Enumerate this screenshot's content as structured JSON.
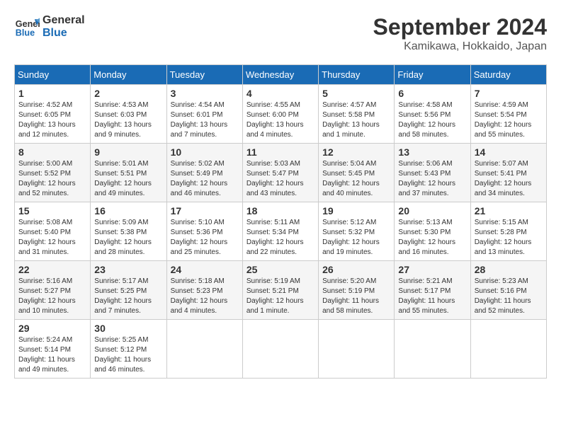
{
  "header": {
    "logo_line1": "General",
    "logo_line2": "Blue",
    "month": "September 2024",
    "location": "Kamikawa, Hokkaido, Japan"
  },
  "weekdays": [
    "Sunday",
    "Monday",
    "Tuesday",
    "Wednesday",
    "Thursday",
    "Friday",
    "Saturday"
  ],
  "weeks": [
    [
      {
        "day": "1",
        "sunrise": "4:52 AM",
        "sunset": "6:05 PM",
        "daylight": "13 hours and 12 minutes."
      },
      {
        "day": "2",
        "sunrise": "4:53 AM",
        "sunset": "6:03 PM",
        "daylight": "13 hours and 9 minutes."
      },
      {
        "day": "3",
        "sunrise": "4:54 AM",
        "sunset": "6:01 PM",
        "daylight": "13 hours and 7 minutes."
      },
      {
        "day": "4",
        "sunrise": "4:55 AM",
        "sunset": "6:00 PM",
        "daylight": "13 hours and 4 minutes."
      },
      {
        "day": "5",
        "sunrise": "4:57 AM",
        "sunset": "5:58 PM",
        "daylight": "13 hours and 1 minute."
      },
      {
        "day": "6",
        "sunrise": "4:58 AM",
        "sunset": "5:56 PM",
        "daylight": "12 hours and 58 minutes."
      },
      {
        "day": "7",
        "sunrise": "4:59 AM",
        "sunset": "5:54 PM",
        "daylight": "12 hours and 55 minutes."
      }
    ],
    [
      {
        "day": "8",
        "sunrise": "5:00 AM",
        "sunset": "5:52 PM",
        "daylight": "12 hours and 52 minutes."
      },
      {
        "day": "9",
        "sunrise": "5:01 AM",
        "sunset": "5:51 PM",
        "daylight": "12 hours and 49 minutes."
      },
      {
        "day": "10",
        "sunrise": "5:02 AM",
        "sunset": "5:49 PM",
        "daylight": "12 hours and 46 minutes."
      },
      {
        "day": "11",
        "sunrise": "5:03 AM",
        "sunset": "5:47 PM",
        "daylight": "12 hours and 43 minutes."
      },
      {
        "day": "12",
        "sunrise": "5:04 AM",
        "sunset": "5:45 PM",
        "daylight": "12 hours and 40 minutes."
      },
      {
        "day": "13",
        "sunrise": "5:06 AM",
        "sunset": "5:43 PM",
        "daylight": "12 hours and 37 minutes."
      },
      {
        "day": "14",
        "sunrise": "5:07 AM",
        "sunset": "5:41 PM",
        "daylight": "12 hours and 34 minutes."
      }
    ],
    [
      {
        "day": "15",
        "sunrise": "5:08 AM",
        "sunset": "5:40 PM",
        "daylight": "12 hours and 31 minutes."
      },
      {
        "day": "16",
        "sunrise": "5:09 AM",
        "sunset": "5:38 PM",
        "daylight": "12 hours and 28 minutes."
      },
      {
        "day": "17",
        "sunrise": "5:10 AM",
        "sunset": "5:36 PM",
        "daylight": "12 hours and 25 minutes."
      },
      {
        "day": "18",
        "sunrise": "5:11 AM",
        "sunset": "5:34 PM",
        "daylight": "12 hours and 22 minutes."
      },
      {
        "day": "19",
        "sunrise": "5:12 AM",
        "sunset": "5:32 PM",
        "daylight": "12 hours and 19 minutes."
      },
      {
        "day": "20",
        "sunrise": "5:13 AM",
        "sunset": "5:30 PM",
        "daylight": "12 hours and 16 minutes."
      },
      {
        "day": "21",
        "sunrise": "5:15 AM",
        "sunset": "5:28 PM",
        "daylight": "12 hours and 13 minutes."
      }
    ],
    [
      {
        "day": "22",
        "sunrise": "5:16 AM",
        "sunset": "5:27 PM",
        "daylight": "12 hours and 10 minutes."
      },
      {
        "day": "23",
        "sunrise": "5:17 AM",
        "sunset": "5:25 PM",
        "daylight": "12 hours and 7 minutes."
      },
      {
        "day": "24",
        "sunrise": "5:18 AM",
        "sunset": "5:23 PM",
        "daylight": "12 hours and 4 minutes."
      },
      {
        "day": "25",
        "sunrise": "5:19 AM",
        "sunset": "5:21 PM",
        "daylight": "12 hours and 1 minute."
      },
      {
        "day": "26",
        "sunrise": "5:20 AM",
        "sunset": "5:19 PM",
        "daylight": "11 hours and 58 minutes."
      },
      {
        "day": "27",
        "sunrise": "5:21 AM",
        "sunset": "5:17 PM",
        "daylight": "11 hours and 55 minutes."
      },
      {
        "day": "28",
        "sunrise": "5:23 AM",
        "sunset": "5:16 PM",
        "daylight": "11 hours and 52 minutes."
      }
    ],
    [
      {
        "day": "29",
        "sunrise": "5:24 AM",
        "sunset": "5:14 PM",
        "daylight": "11 hours and 49 minutes."
      },
      {
        "day": "30",
        "sunrise": "5:25 AM",
        "sunset": "5:12 PM",
        "daylight": "11 hours and 46 minutes."
      },
      null,
      null,
      null,
      null,
      null
    ]
  ]
}
